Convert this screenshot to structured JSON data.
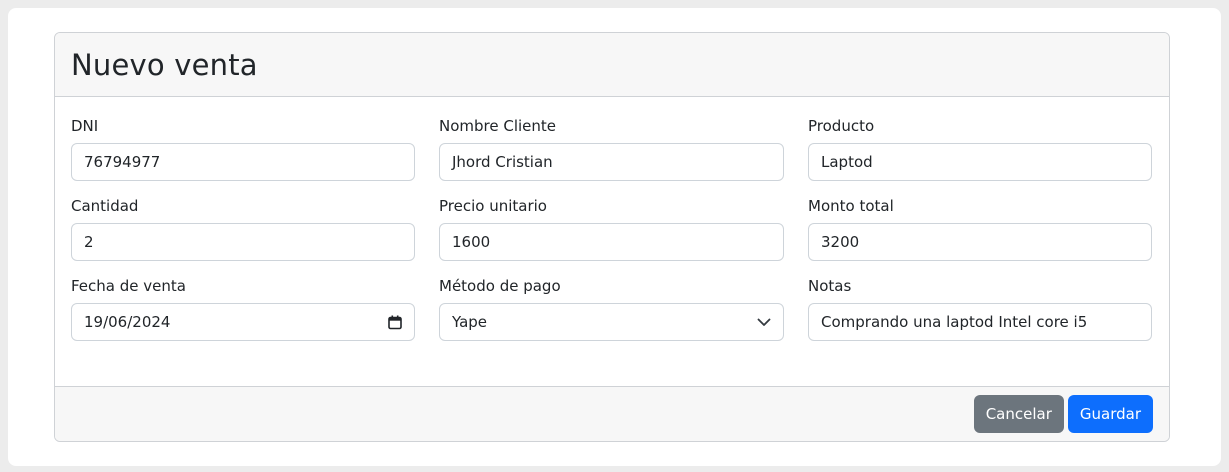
{
  "header": {
    "title": "Nuevo venta"
  },
  "form": {
    "dni": {
      "label": "DNI",
      "value": "76794977"
    },
    "nombre_cliente": {
      "label": "Nombre Cliente",
      "value": "Jhord Cristian"
    },
    "producto": {
      "label": "Producto",
      "value": "Laptod"
    },
    "cantidad": {
      "label": "Cantidad",
      "value": "2"
    },
    "precio_unitario": {
      "label": "Precio unitario",
      "value": "1600"
    },
    "monto_total": {
      "label": "Monto total",
      "value": "3200"
    },
    "fecha_venta": {
      "label": "Fecha de venta",
      "value": "19/06/2024"
    },
    "metodo_pago": {
      "label": "Método de pago",
      "value": "Yape"
    },
    "notas": {
      "label": "Notas",
      "value": "Comprando una laptod Intel core i5"
    }
  },
  "footer": {
    "cancel_label": "Cancelar",
    "save_label": "Guardar"
  },
  "icons": {
    "date": "calendar-icon",
    "select": "chevron-down-icon"
  },
  "colors": {
    "primary": "#0d6efd",
    "secondary": "#6c757d"
  }
}
